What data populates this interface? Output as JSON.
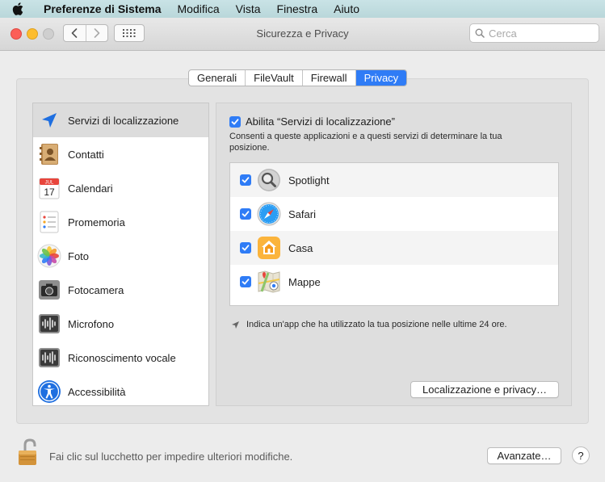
{
  "menubar": {
    "app": "Preferenze di Sistema",
    "items": [
      "Modifica",
      "Vista",
      "Finestra",
      "Aiuto"
    ]
  },
  "window": {
    "title": "Sicurezza e Privacy",
    "search_placeholder": "Cerca"
  },
  "tabs": [
    {
      "label": "Generali",
      "active": false
    },
    {
      "label": "FileVault",
      "active": false
    },
    {
      "label": "Firewall",
      "active": false
    },
    {
      "label": "Privacy",
      "active": true
    }
  ],
  "sidebar": {
    "items": [
      {
        "label": "Servizi di localizzazione",
        "icon": "location-arrow-icon",
        "selected": true
      },
      {
        "label": "Contatti",
        "icon": "contacts-icon",
        "selected": false
      },
      {
        "label": "Calendari",
        "icon": "calendar-icon",
        "selected": false,
        "icon_month": "JUL",
        "icon_day": "17"
      },
      {
        "label": "Promemoria",
        "icon": "reminders-icon",
        "selected": false
      },
      {
        "label": "Foto",
        "icon": "photos-icon",
        "selected": false
      },
      {
        "label": "Fotocamera",
        "icon": "camera-icon",
        "selected": false
      },
      {
        "label": "Microfono",
        "icon": "microphone-icon",
        "selected": false
      },
      {
        "label": "Riconoscimento vocale",
        "icon": "speech-recognition-icon",
        "selected": false
      },
      {
        "label": "Accessibilità",
        "icon": "accessibility-icon",
        "selected": false
      }
    ]
  },
  "location": {
    "enable_label": "Abilita “Servizi di localizzazione”",
    "enable_checked": true,
    "description": "Consenti a queste applicazioni e a questi servizi di determinare la tua posizione.",
    "apps": [
      {
        "label": "Spotlight",
        "icon": "spotlight-icon",
        "checked": true
      },
      {
        "label": "Safari",
        "icon": "safari-icon",
        "checked": true
      },
      {
        "label": "Casa",
        "icon": "home-icon",
        "checked": true
      },
      {
        "label": "Mappe",
        "icon": "maps-icon",
        "checked": true
      }
    ],
    "hint": "Indica un'app che ha utilizzato la tua posizione nelle ultime 24 ore.",
    "details_button": "Localizzazione e privacy…"
  },
  "footer": {
    "lock_text": "Fai clic sul lucchetto per impedire ulteriori modifiche.",
    "advanced_button": "Avanzate…",
    "help_label": "?"
  },
  "colors": {
    "accent": "#2f7cf6",
    "close": "#fc5f57",
    "minimize": "#fdbd2e",
    "zoom": "#cfcfcf"
  }
}
